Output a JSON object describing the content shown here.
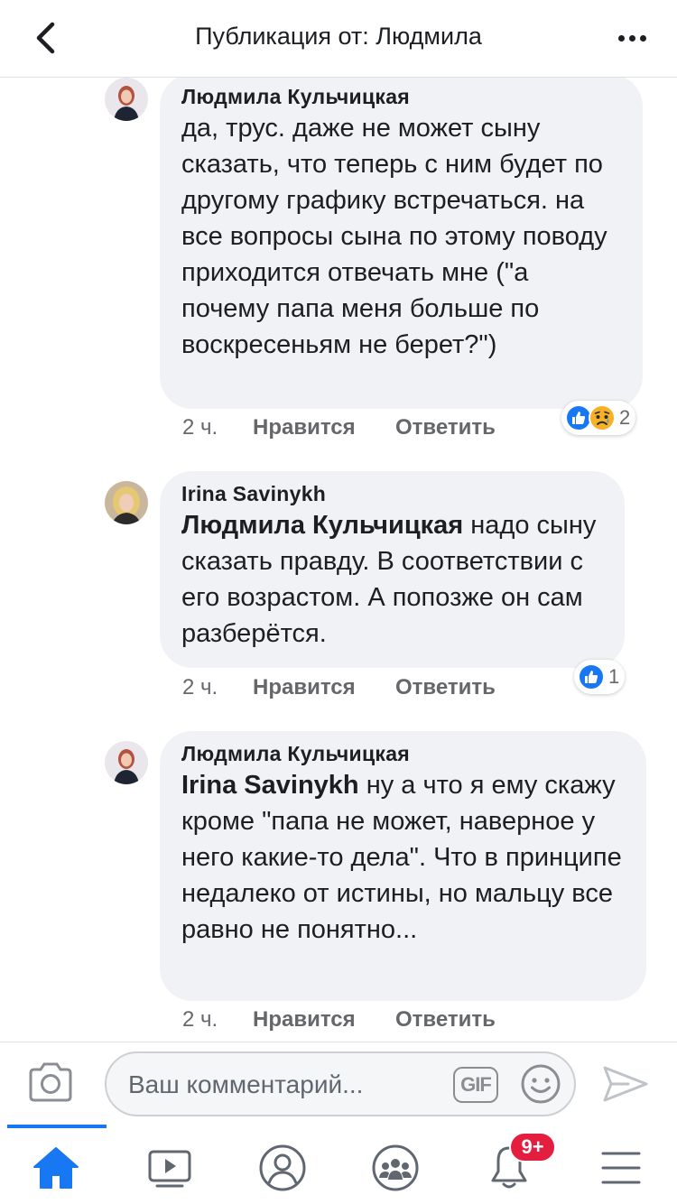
{
  "header": {
    "title": "Публикация от: Людмила"
  },
  "comments": [
    {
      "author": "Людмила Кульчицкая",
      "mention": "",
      "text": "да, трус. даже не может сыну сказать, что теперь с ним будет по другому графику встречаться. на все вопросы сына по этому поводу приходится отвечать мне (\"а почему папа меня больше по воскресеньям не берет?\")",
      "time": "2 ч.",
      "like_label": "Нравится",
      "reply_label": "Ответить",
      "reaction_count": "2",
      "reactions": [
        "like-icon",
        "sad-icon"
      ]
    },
    {
      "author": "Irina Savinykh",
      "mention": "Людмила Кульчицкая",
      "text": "надо сыну сказать правду. В соответствии с его возрастом. А попозже он сам разберётся.",
      "time": "2 ч.",
      "like_label": "Нравится",
      "reply_label": "Ответить",
      "reaction_count": "1",
      "reactions": [
        "like-icon"
      ]
    },
    {
      "author": "Людмила Кульчицкая",
      "mention": "Irina Savinykh",
      "text": "ну а что я ему скажу кроме \"папа не может, наверное у него какие-то дела\". Что в принципе недалеко от истины, но мальцу все равно не понятно...",
      "time": "2 ч.",
      "like_label": "Нравится",
      "reply_label": "Ответить"
    }
  ],
  "composer": {
    "placeholder": "Ваш комментарий...",
    "gif_label": "GIF"
  },
  "bottom_nav": {
    "items": [
      "home-icon",
      "watch-icon",
      "profile-icon",
      "groups-icon",
      "notifications-icon",
      "menu-icon"
    ],
    "notifications_badge": "9+"
  },
  "colors": {
    "accent": "#1877f2",
    "bubble": "#f0f2f5",
    "badge": "#e41e3f",
    "meta_text": "#65676b"
  }
}
